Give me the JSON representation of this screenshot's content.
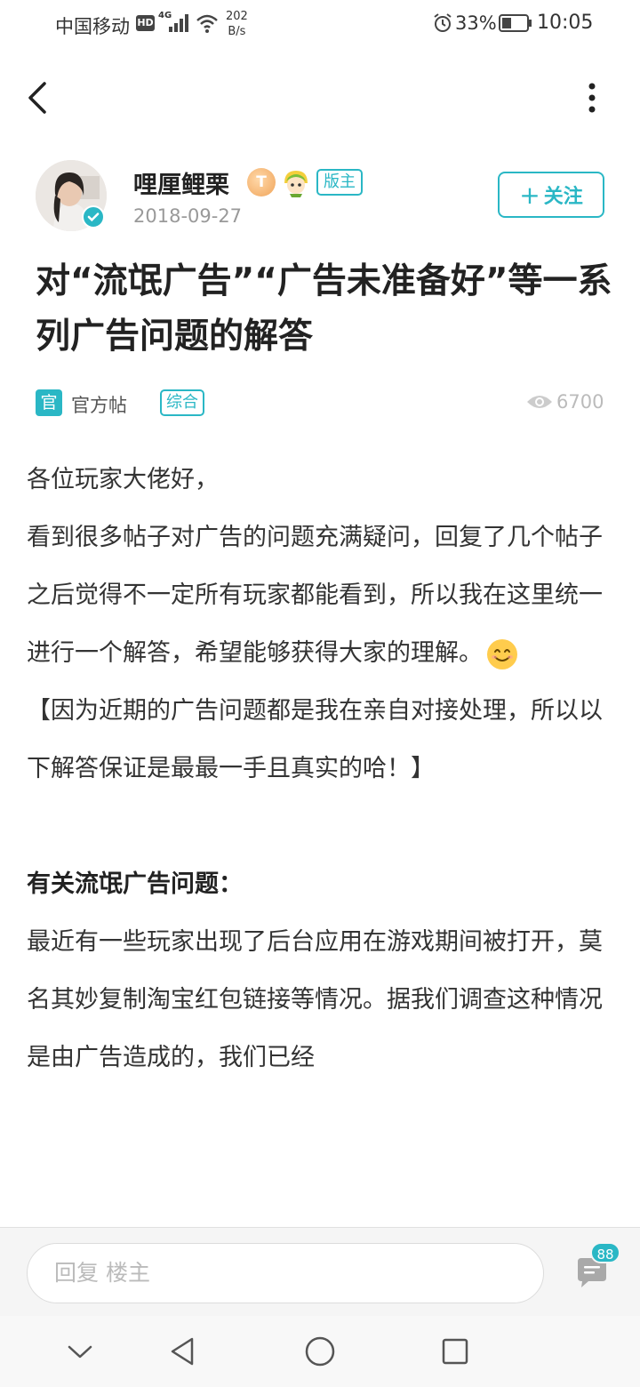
{
  "status_bar": {
    "carrier": "中国移动",
    "hd": "HD",
    "network": "4G",
    "speed_value": "202",
    "speed_unit": "B/s",
    "battery": "33%",
    "time": "10:05"
  },
  "author": {
    "name": "哩厘鲤栗",
    "level_badge": "T",
    "role_badge": "版主",
    "date": "2018-09-27",
    "follow_label": "关注"
  },
  "post": {
    "title": "对“流氓广告”“广告未准备好”等一系列广告问题的解答",
    "official_icon": "官",
    "official_label": "官方帖",
    "topic_tag": "综合",
    "views": "6700",
    "paragraphs": [
      "各位玩家大佬好，",
      "看到很多帖子对广告的问题充满疑问，回复了几个帖子之后觉得不一定所有玩家都能看到，所以我在这里统一进行一个解答，希望能够获得大家的理解。",
      "【因为近期的广告问题都是我在亲自对接处理，所以以下解答保证是最最一手且真实的哈！】"
    ],
    "section_heading": "有关流氓广告问题：",
    "section_text": "最近有一些玩家出现了后台应用在游戏期间被打开，莫名其妙复制淘宝红包链接等情况。据我们调查这种情况是由广告造成的，我们已经"
  },
  "reply_bar": {
    "placeholder": "回复  楼主",
    "comment_count": "88"
  },
  "colors": {
    "accent": "#2ab7c5"
  }
}
